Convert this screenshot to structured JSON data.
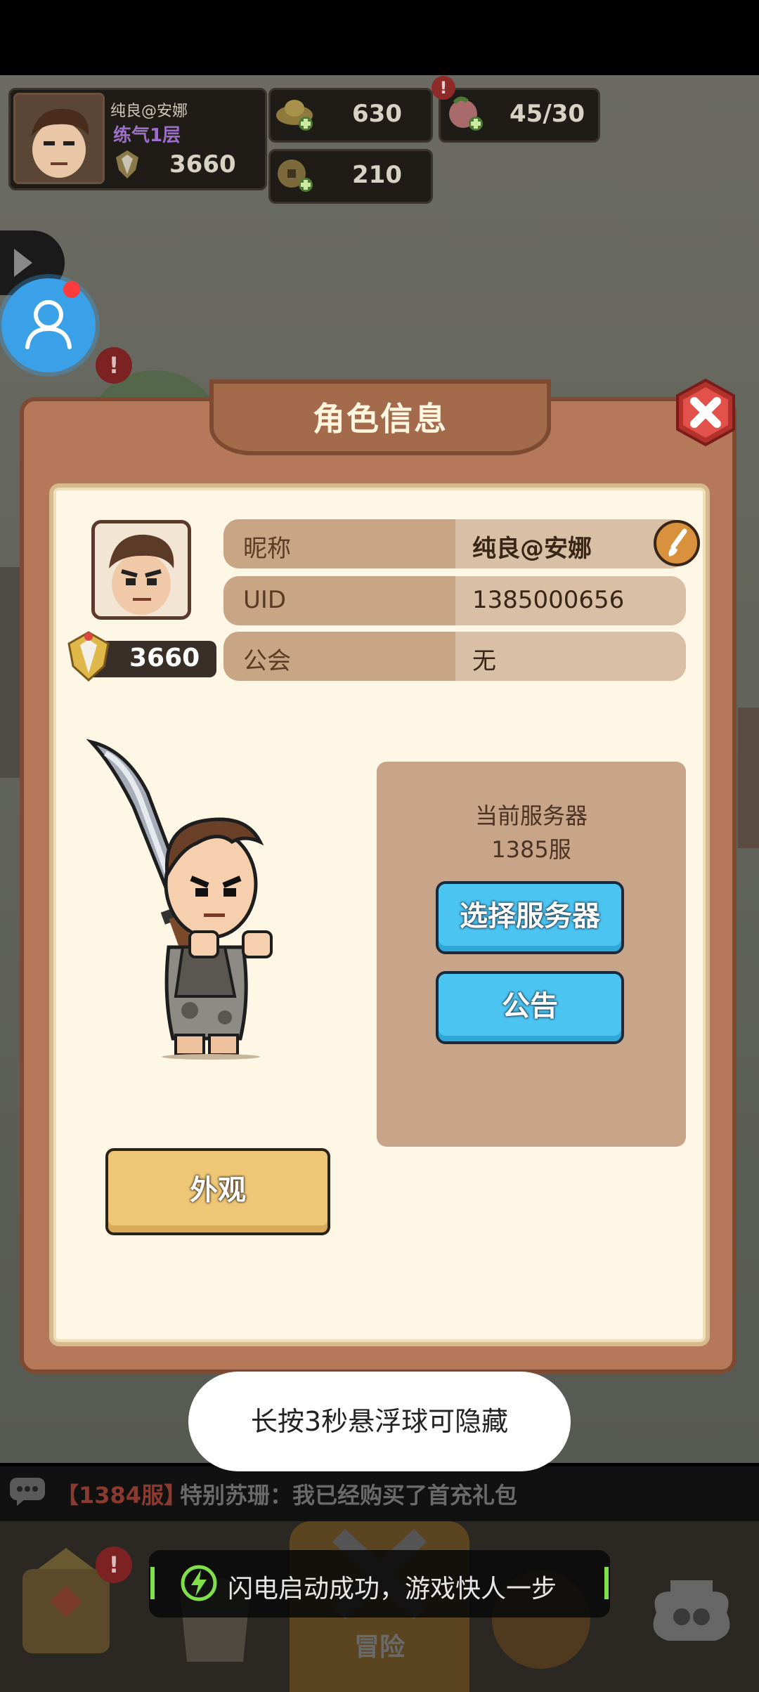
{
  "player": {
    "name": "纯良@安娜",
    "realm": "练气1层",
    "power": "3660"
  },
  "resources": {
    "gold_ingot": "630",
    "copper_coin": "210",
    "peach_stamina": "45/30"
  },
  "dialog": {
    "title": "角色信息",
    "nickname_label": "昵称",
    "nickname_value": "纯良@安娜",
    "uid_label": "UID",
    "uid_value": "1385000656",
    "guild_label": "公会",
    "guild_value": "无",
    "power": "3660",
    "server_caption": "当前服务器",
    "server_name": "1385服",
    "select_server_btn": "选择服务器",
    "notice_btn": "公告",
    "appearance_btn": "外观"
  },
  "toast": "长按3秒悬浮球可隐藏",
  "chat": {
    "server_tag": "【1384服】",
    "message": "特别苏珊：我已经购买了首充礼包"
  },
  "bottom_nav": {
    "adventure_label": "冒险"
  },
  "lightning_toast": "闪电启动成功，游戏快人一步",
  "colors": {
    "panel_brown": "#b5785a",
    "inner_cream": "#fff7e6",
    "button_blue": "#4cc4f2",
    "button_gold": "#efc675",
    "close_red": "#e2524a",
    "realm_purple": "#b07ce0",
    "chat_tag_red": "#d84a3a",
    "lightning_green": "#7fe04a"
  }
}
